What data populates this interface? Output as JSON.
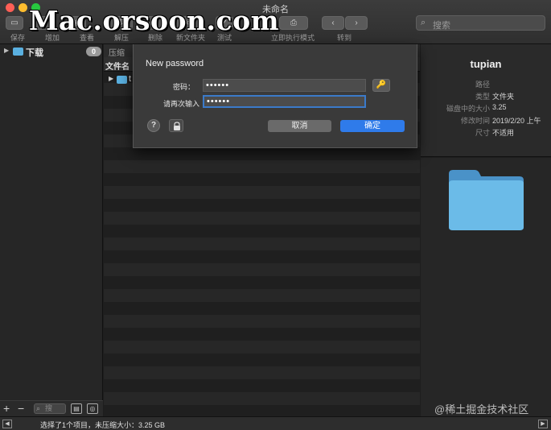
{
  "window": {
    "title": "未命名"
  },
  "watermark": "Mac.orsoon.com",
  "toolbar": {
    "buttons": [
      {
        "label": "保存",
        "icon": "save-icon"
      },
      {
        "label": "增加",
        "icon": "add-icon"
      },
      {
        "label": "查看",
        "icon": "view-icon"
      },
      {
        "label": "解压",
        "icon": "extract-icon"
      },
      {
        "label": "删除",
        "icon": "delete-icon"
      },
      {
        "label": "新文件夹",
        "icon": "new-folder-icon"
      },
      {
        "label": "测试",
        "icon": "test-icon"
      },
      {
        "label": "立即执行模式",
        "icon": "execute-icon"
      },
      {
        "label": "转到",
        "icon": "navigate-icon"
      }
    ],
    "back_glyph": "‹",
    "forward_glyph": "›"
  },
  "search": {
    "placeholder": "搜索"
  },
  "sidebar": {
    "items": [
      {
        "label": "下载",
        "badge": "0"
      }
    ],
    "footer": {
      "add": "+",
      "remove": "−",
      "filter_placeholder": "搜"
    }
  },
  "list": {
    "header_top": "压缩",
    "column_name": "文件名",
    "rows": [
      {
        "name": "t"
      }
    ]
  },
  "info": {
    "name": "tupian",
    "rows": [
      {
        "key": "路径",
        "value": ""
      },
      {
        "key": "类型",
        "value": "文件夹"
      },
      {
        "key": "磁盘中的大小",
        "value": "3.25"
      },
      {
        "key": "修改时间",
        "value": "2019/2/20 上午"
      },
      {
        "key": "尺寸",
        "value": "不适用"
      }
    ]
  },
  "dialog": {
    "title": "New password",
    "password_label": "密码：",
    "password_value": "••••••",
    "confirm_label": "请再次输入",
    "confirm_value": "••••••",
    "help": "?",
    "cancel": "取消",
    "ok": "确定"
  },
  "status": {
    "text": "选择了1个项目，未压缩大小：3.25 GB"
  },
  "credit": "@稀土掘金技术社区",
  "colors": {
    "accent": "#2f7bea",
    "folder": "#5ab0e0"
  }
}
